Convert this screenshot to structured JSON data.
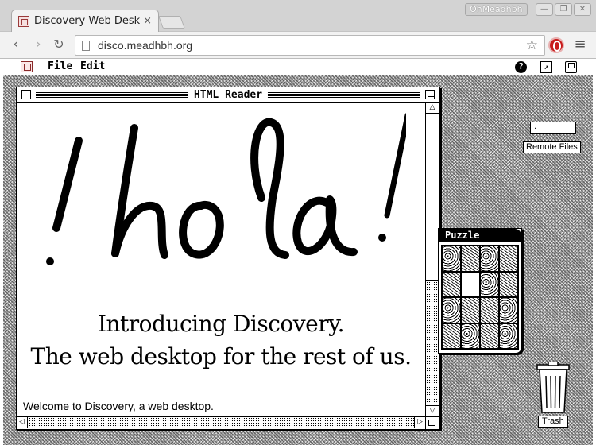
{
  "browser": {
    "tab_title": "Discovery Web Deskt",
    "tab_close": "×",
    "profile_name": "OhMeadhbh",
    "url": "disco.meadhbh.org",
    "window_buttons": [
      "—",
      "❐",
      "✕"
    ]
  },
  "desktop": {
    "menus": {
      "file": "File",
      "edit": "Edit"
    },
    "menubar_icons": [
      "help-icon",
      "fullscreen-icon",
      "save-icon"
    ],
    "help_glyph": "?",
    "reader": {
      "title": "HTML Reader",
      "hero_image_text": "¡hola!",
      "intro_line1": "Introducing Discovery.",
      "intro_line2": "The web desktop for the rest of us.",
      "welcome": "Welcome to Discovery, a web desktop."
    },
    "puzzle": {
      "title": "Puzzle"
    },
    "remote_files": {
      "field_value": ".",
      "label": "Remote Files"
    },
    "trash": {
      "label": "Trash"
    }
  },
  "colors": {
    "desktop_dark": "#5f5f5f",
    "desktop_light": "#ededed",
    "opera_red": "#c81a1a"
  }
}
